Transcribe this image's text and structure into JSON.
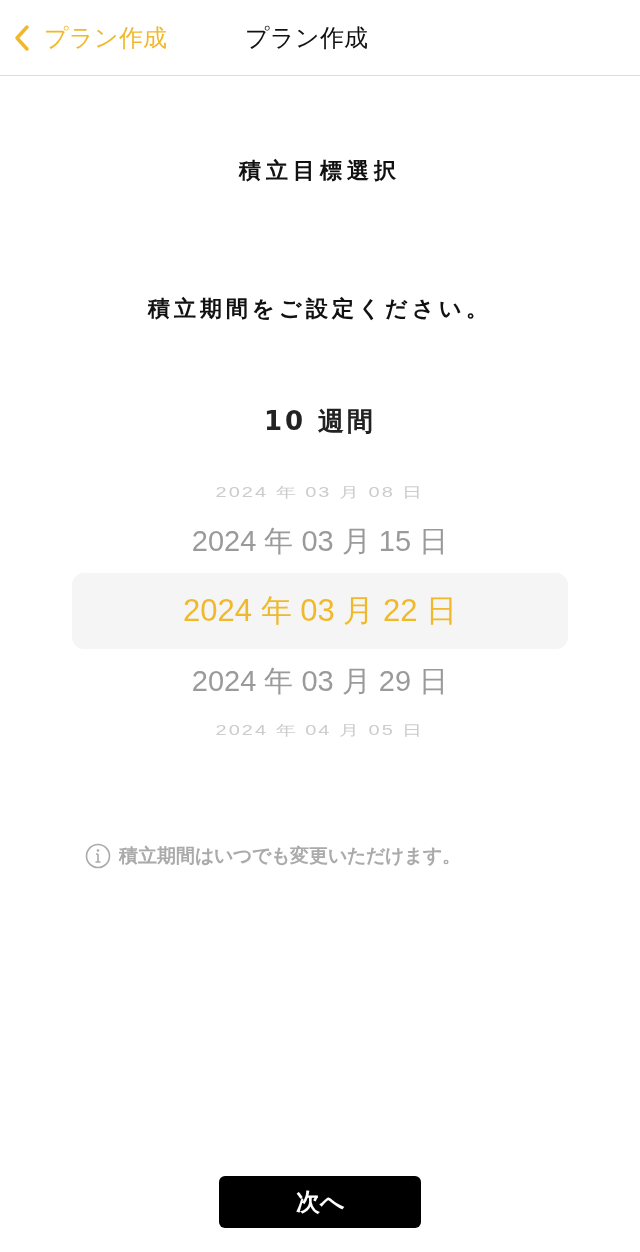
{
  "nav": {
    "back_label": "プラン作成",
    "title": "プラン作成"
  },
  "heading": "積立目標選択",
  "prompt": "積立期間をご設定ください。",
  "duration": "10 週間",
  "picker": [
    {
      "label": "2024 年 03 月 08 日",
      "selected": false
    },
    {
      "label": "2024 年 03 月 15 日",
      "selected": false
    },
    {
      "label": "2024 年 03 月 22 日",
      "selected": true
    },
    {
      "label": "2024 年 03 月 29 日",
      "selected": false
    },
    {
      "label": "2024 年 04 月 05 日",
      "selected": false
    }
  ],
  "note": "積立期間はいつでも変更いただけます。",
  "next_button": "次へ"
}
